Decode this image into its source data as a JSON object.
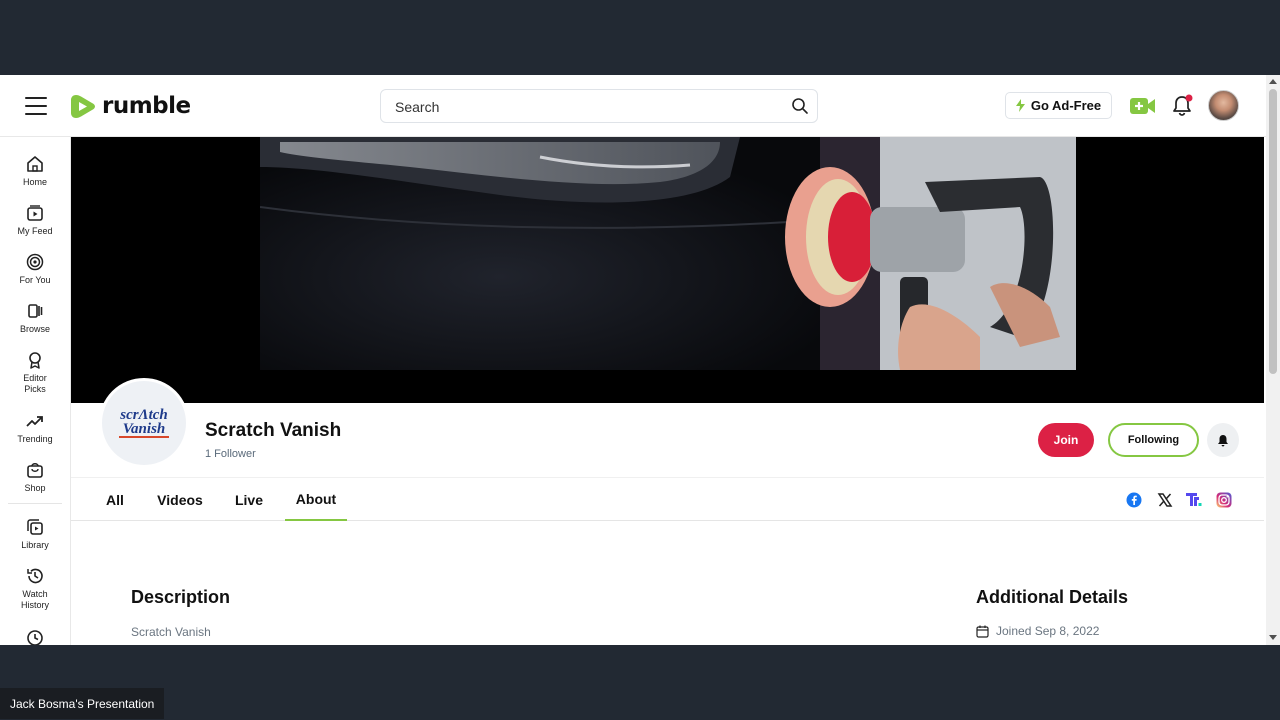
{
  "header": {
    "logo_text": "rumble",
    "search_placeholder": "Search",
    "ad_free_label": "Go Ad-Free"
  },
  "sidebar": {
    "items": [
      {
        "label": "Home",
        "icon": "home-icon"
      },
      {
        "label": "My Feed",
        "icon": "feed-icon"
      },
      {
        "label": "For You",
        "icon": "target-icon"
      },
      {
        "label": "Browse",
        "icon": "browse-icon"
      },
      {
        "label": "Editor Picks",
        "icon": "award-icon"
      },
      {
        "label": "Trending",
        "icon": "trending-icon"
      },
      {
        "label": "Shop",
        "icon": "shop-icon"
      },
      {
        "label": "Library",
        "icon": "library-icon"
      },
      {
        "label": "Watch History",
        "icon": "history-icon"
      }
    ]
  },
  "channel": {
    "name": "Scratch Vanish",
    "followers": "1 Follower",
    "logo_text_line1": "scrΛtch",
    "logo_text_line2": "Vanish",
    "join_label": "Join",
    "following_label": "Following"
  },
  "tabs": [
    {
      "label": "All",
      "active": false
    },
    {
      "label": "Videos",
      "active": false
    },
    {
      "label": "Live",
      "active": false
    },
    {
      "label": "About",
      "active": true
    }
  ],
  "about": {
    "description_title": "Description",
    "description_text": "Scratch Vanish",
    "details_title": "Additional Details",
    "joined_text": "Joined Sep 8, 2022"
  },
  "colors": {
    "brand_green": "#85c742",
    "join_red": "#dc2145",
    "page_bg": "#222933"
  },
  "presenter_label": "Jack Bosma's Presentation"
}
